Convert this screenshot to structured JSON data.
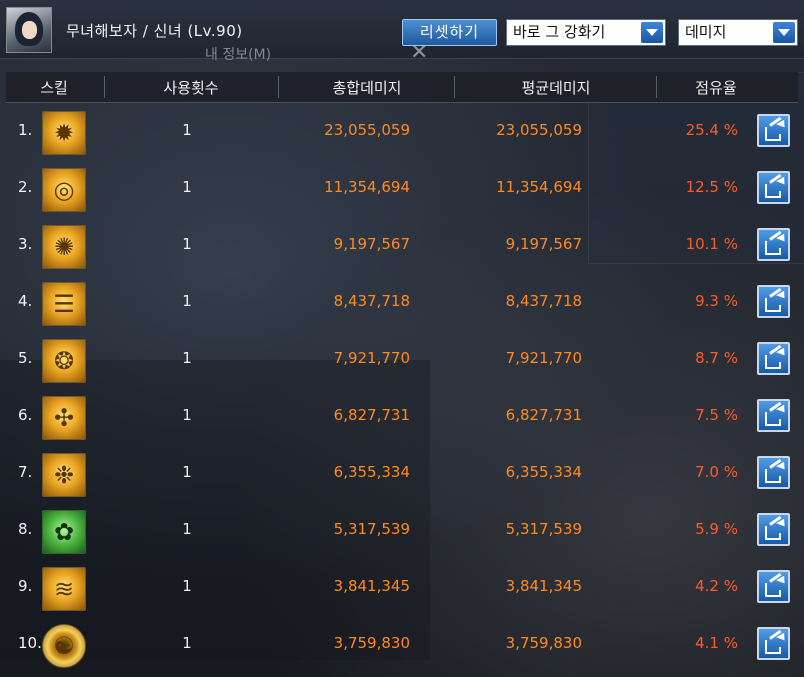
{
  "header": {
    "character_title": "무녀해보자 / 신녀 (Lv.90)",
    "window_subtitle": "내 정보(M)",
    "reset_label": "리셋하기",
    "category_select": "바로 그 강화기",
    "metric_select": "데미지"
  },
  "columns": {
    "skill": "스킬",
    "uses": "사용횟수",
    "total": "총합데미지",
    "average": "평균데미지",
    "share": "점유율"
  },
  "rows": [
    {
      "rank": "1.",
      "uses": "1",
      "total": "23,055,059",
      "average": "23,055,059",
      "share": "25.4 %",
      "icon": "fire-lion-icon"
    },
    {
      "rank": "2.",
      "uses": "1",
      "total": "11,354,694",
      "average": "11,354,694",
      "share": "12.5 %",
      "icon": "vortex-icon"
    },
    {
      "rank": "3.",
      "uses": "1",
      "total": "9,197,567",
      "average": "9,197,567",
      "share": "10.1 %",
      "icon": "burst-icon"
    },
    {
      "rank": "4.",
      "uses": "1",
      "total": "8,437,718",
      "average": "8,437,718",
      "share": "9.3 %",
      "icon": "scroll-icon"
    },
    {
      "rank": "5.",
      "uses": "1",
      "total": "7,921,770",
      "average": "7,921,770",
      "share": "8.7 %",
      "icon": "dragon-icon"
    },
    {
      "rank": "6.",
      "uses": "1",
      "total": "6,827,731",
      "average": "6,827,731",
      "share": "7.5 %",
      "icon": "spirit-icon"
    },
    {
      "rank": "7.",
      "uses": "1",
      "total": "6,355,334",
      "average": "6,355,334",
      "share": "7.0 %",
      "icon": "swirl-icon"
    },
    {
      "rank": "8.",
      "uses": "1",
      "total": "5,317,539",
      "average": "5,317,539",
      "share": "5.9 %",
      "icon": "green-beast-icon"
    },
    {
      "rank": "9.",
      "uses": "1",
      "total": "3,841,345",
      "average": "3,841,345",
      "share": "4.2 %",
      "icon": "wind-icon"
    },
    {
      "rank": "10.",
      "uses": "1",
      "total": "3,759,830",
      "average": "3,759,830",
      "share": "4.1 %",
      "icon": "yin-yang-icon"
    }
  ],
  "colors": {
    "damage_text": "#ff8a1e",
    "share_text": "#ff5a2a",
    "button_blue": "#1e5a9f"
  }
}
